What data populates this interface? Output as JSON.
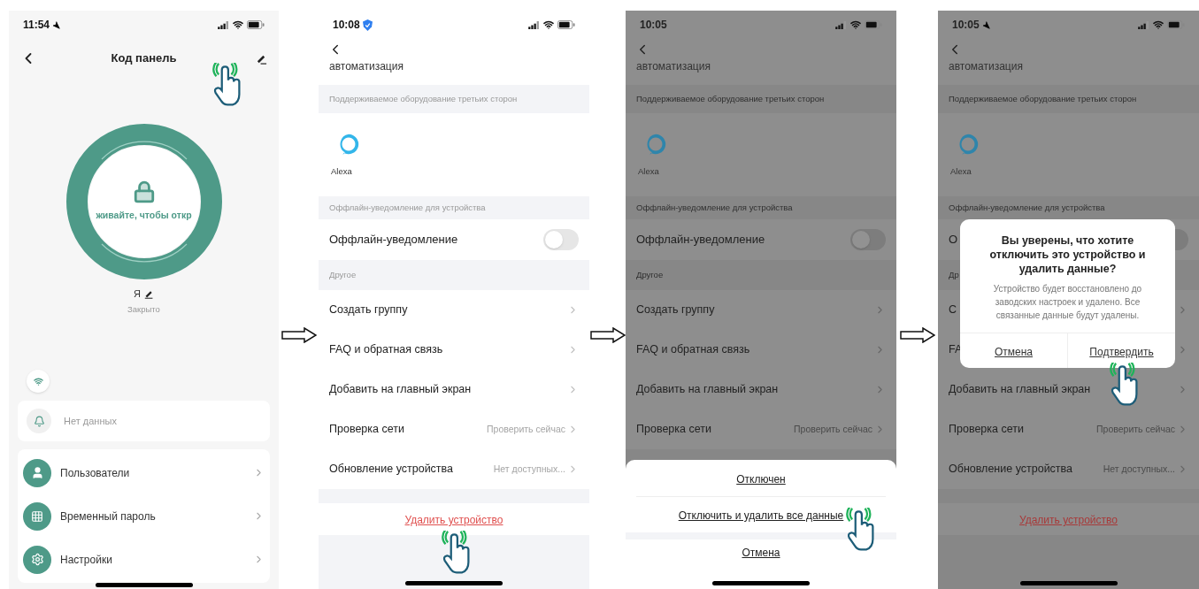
{
  "screens": [
    {
      "kind": "device",
      "time": "11:54",
      "title": "Код панель",
      "edit_tapped": true,
      "ring_text": "живайте, чтобы откр",
      "user_name": "Я",
      "lock_state": "Закрыто",
      "notice": "Нет данных",
      "menu": [
        {
          "label": "Пользователи"
        },
        {
          "label": "Временный пароль"
        },
        {
          "label": "Настройки"
        }
      ]
    },
    {
      "kind": "settings",
      "time": "10:08",
      "dimmed": false,
      "top_label": "автоматизация",
      "third_party_header": "Поддерживаемое оборудование третьих сторон",
      "alexa_label": "Alexa",
      "offline_header": "Оффлайн-уведомление для устройства",
      "offline_label": "Оффлайн-уведомление",
      "offline_on": false,
      "other_header": "Другое",
      "rows": [
        {
          "label": "Создать группу"
        },
        {
          "label": "FAQ и обратная связь"
        },
        {
          "label": "Добавить на главный экран"
        },
        {
          "label": "Проверка сети",
          "value": "Проверить сейчас"
        },
        {
          "label": "Обновление устройства",
          "value": "Нет доступных..."
        }
      ],
      "delete": {
        "label": "Удалить устройство",
        "tapped": true
      }
    },
    {
      "kind": "settings",
      "time": "10:05",
      "dimmed": true,
      "top_label": "автоматизация",
      "third_party_header": "Поддерживаемое оборудование третьих сторон",
      "alexa_label": "Alexa",
      "offline_header": "Оффлайн-уведомление для устройства",
      "offline_label": "Оффлайн-уведомление",
      "offline_on": false,
      "other_header": "Другое",
      "rows": [
        {
          "label": "Создать группу"
        },
        {
          "label": "FAQ и обратная связь"
        },
        {
          "label": "Добавить на главный экран"
        },
        {
          "label": "Проверка сети",
          "value": "Проверить сейчас"
        }
      ],
      "sheet": {
        "options": [
          {
            "label": "Отключен"
          },
          {
            "label": "Отключить и удалить все данные",
            "tapped": true
          }
        ],
        "cancel": "Отмена"
      }
    },
    {
      "kind": "settings",
      "time": "10:05",
      "dimmed": true,
      "top_label": "автоматизация",
      "third_party_header": "Поддерживаемое оборудование третьих сторон",
      "alexa_label": "Alexa",
      "offline_header": "Оффлайн-уведомление для устройства",
      "offline_label": "О",
      "offline_on": false,
      "other_header": "Др",
      "rows": [
        {
          "label": "С"
        },
        {
          "label": "FA"
        },
        {
          "label": "Добавить на главный экран"
        },
        {
          "label": "Проверка сети",
          "value": "Проверить сейчас"
        },
        {
          "label": "Обновление устройства",
          "value": "Нет доступных..."
        }
      ],
      "delete": {
        "label": "Удалить устройство"
      },
      "dialog": {
        "title": "Вы уверены, что хотите отключить это устройство и удалить данные?",
        "message": "Устройство будет восстановлено до заводских настроек и удалено. Все связанные данные будут удалены.",
        "buttons": [
          {
            "label": "Отмена"
          },
          {
            "label": "Подтвердить",
            "tapped": true
          }
        ]
      }
    }
  ]
}
